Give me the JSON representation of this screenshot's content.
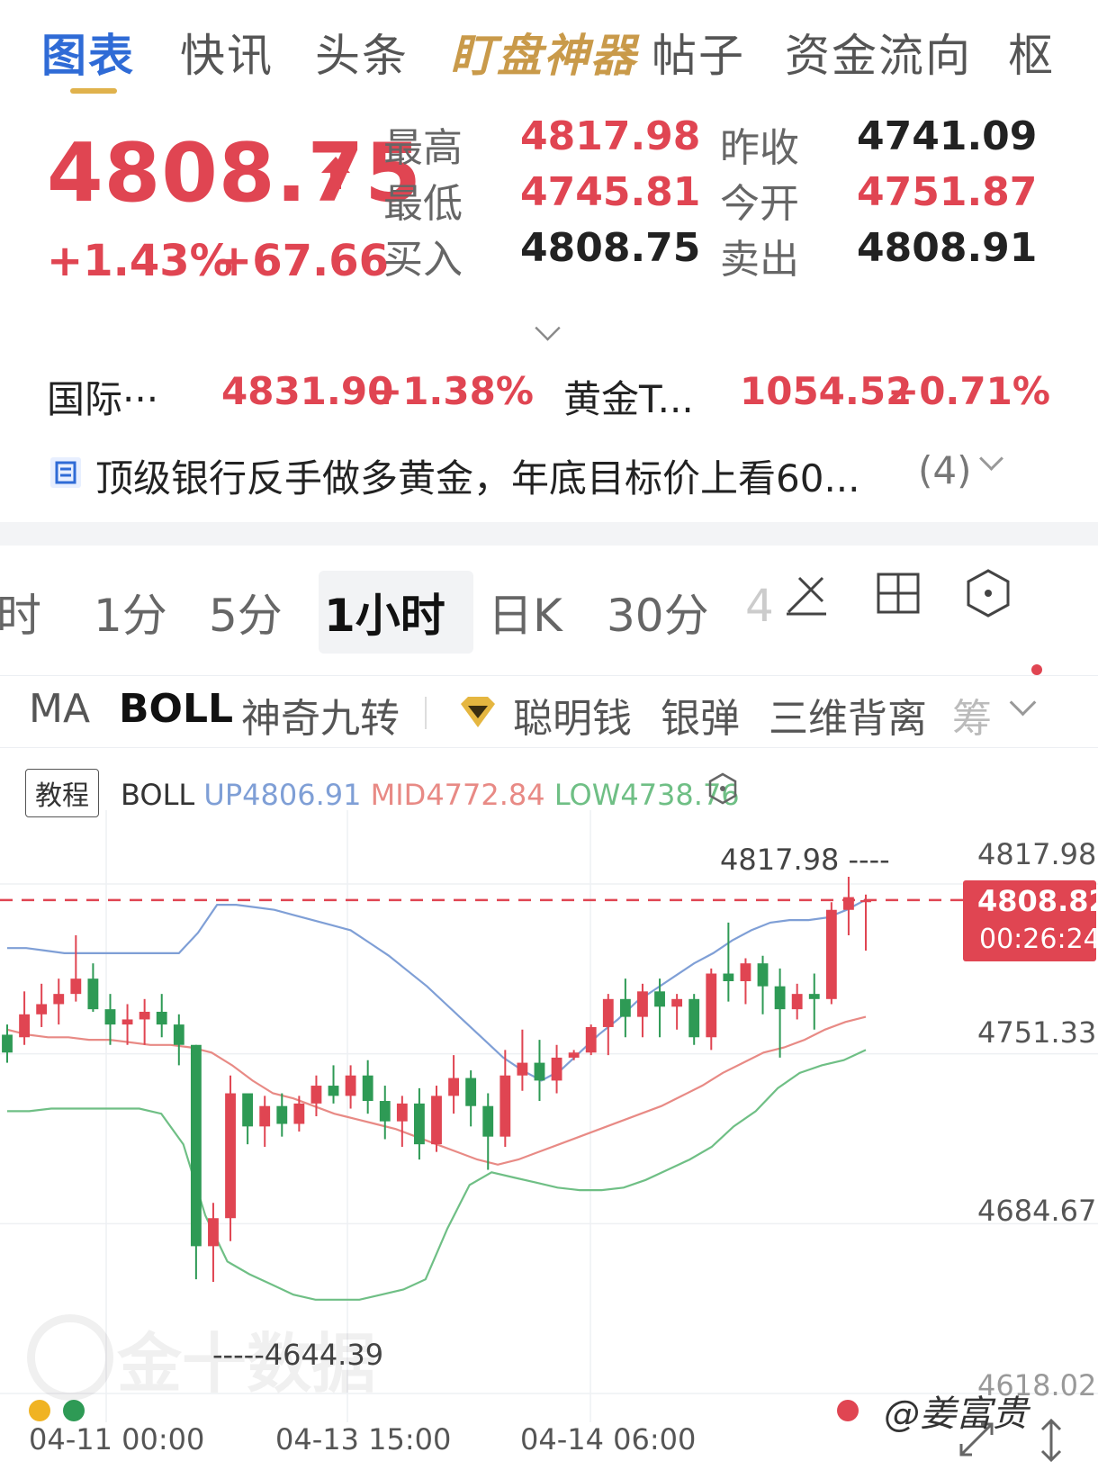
{
  "tabs": [
    "图表",
    "快讯",
    "头条",
    "盯盘神器",
    "帖子",
    "资金流向",
    "枢"
  ],
  "quote": {
    "price": "4808.75",
    "change_pct": "+1.43%",
    "change_abs": "+67.66",
    "high_label": "最高",
    "high": "4817.98",
    "low_label": "最低",
    "low": "4745.81",
    "bid_label": "买入",
    "bid": "4808.75",
    "prev_close_label": "昨收",
    "prev_close": "4741.09",
    "open_label": "今开",
    "open": "4751.87",
    "ask_label": "卖出",
    "ask": "4808.91"
  },
  "related": [
    {
      "name": "国际···",
      "price": "4831.90",
      "change": "+1.38%"
    },
    {
      "name": "黄金T...",
      "price": "1054.52",
      "change": "+0.71%"
    }
  ],
  "news": {
    "text": "顶级银行反手做多黄金，年底目标价上看60...",
    "count": "(4)"
  },
  "periods": [
    "时",
    "1分",
    "5分",
    "1小时",
    "日K",
    "30分",
    "4"
  ],
  "indicators": [
    "MA",
    "BOLL",
    "神奇九转",
    "聪明钱",
    "银弹",
    "三维背离",
    "筹"
  ],
  "chart_header": {
    "tutorial": "教程",
    "name": "BOLL",
    "up": "UP4806.91",
    "mid": "MID4772.84",
    "low": "LOW4738.76"
  },
  "chart_labels": {
    "high_marker": "4817.98 ----",
    "low_marker": "-----4644.39",
    "watermark": "金十数据",
    "credit": "@姜富贵"
  },
  "colors": {
    "up": "#e04552",
    "down": "#2e9a55",
    "up_band": "#7f9fd6",
    "mid_band": "#e88a85",
    "low_band": "#6fbf85",
    "accent": "#2f6bd6"
  },
  "chart_data": {
    "type": "candlestick",
    "indicator": "BOLL",
    "y_ticks": [
      "4817.98",
      "4751.33",
      "4684.67",
      "4618.02"
    ],
    "current_price": "4808.82",
    "countdown": "00:26:24",
    "x_ticks": [
      "04-11 00:00",
      "04-13 15:00",
      "04-14 06:00"
    ],
    "ylim": [
      4618.02,
      4817.98
    ],
    "candles": [
      [
        4756,
        4760,
        4745,
        4749
      ],
      [
        4755,
        4773,
        4752,
        4764
      ],
      [
        4764,
        4776,
        4759,
        4768
      ],
      [
        4768,
        4778,
        4760,
        4772
      ],
      [
        4772,
        4795,
        4769,
        4778
      ],
      [
        4778,
        4784,
        4765,
        4766
      ],
      [
        4766,
        4772,
        4752,
        4760
      ],
      [
        4760,
        4768,
        4752,
        4762
      ],
      [
        4762,
        4770,
        4752,
        4765
      ],
      [
        4765,
        4772,
        4755,
        4760
      ],
      [
        4760,
        4764,
        4744,
        4752
      ],
      [
        4752,
        4752,
        4660,
        4673
      ],
      [
        4673,
        4690,
        4659,
        4684
      ],
      [
        4684,
        4740,
        4675,
        4733
      ],
      [
        4733,
        4728,
        4713,
        4720
      ],
      [
        4720,
        4732,
        4712,
        4728
      ],
      [
        4728,
        4733,
        4716,
        4721
      ],
      [
        4721,
        4732,
        4718,
        4729
      ],
      [
        4729,
        4740,
        4724,
        4736
      ],
      [
        4736,
        4744,
        4729,
        4732
      ],
      [
        4732,
        4744,
        4727,
        4740
      ],
      [
        4740,
        4746,
        4725,
        4730
      ],
      [
        4730,
        4736,
        4715,
        4722
      ],
      [
        4722,
        4732,
        4712,
        4729
      ],
      [
        4729,
        4735,
        4707,
        4713
      ],
      [
        4713,
        4736,
        4710,
        4732
      ],
      [
        4732,
        4748,
        4725,
        4739
      ],
      [
        4739,
        4742,
        4720,
        4728
      ],
      [
        4728,
        4733,
        4703,
        4716
      ],
      [
        4716,
        4750,
        4712,
        4740
      ],
      [
        4740,
        4758,
        4734,
        4745
      ],
      [
        4745,
        4754,
        4730,
        4738
      ],
      [
        4738,
        4752,
        4733,
        4747
      ],
      [
        4747,
        4750,
        4746,
        4749
      ],
      [
        4749,
        4760,
        4748,
        4759
      ],
      [
        4759,
        4772,
        4748,
        4770
      ],
      [
        4770,
        4778,
        4755,
        4763
      ],
      [
        4763,
        4776,
        4755,
        4773
      ],
      [
        4773,
        4778,
        4755,
        4767
      ],
      [
        4767,
        4772,
        4758,
        4770
      ],
      [
        4770,
        4772,
        4752,
        4755
      ],
      [
        4755,
        4782,
        4750,
        4780
      ],
      [
        4780,
        4800,
        4769,
        4777
      ],
      [
        4777,
        4786,
        4768,
        4784
      ],
      [
        4784,
        4787,
        4764,
        4775
      ],
      [
        4775,
        4782,
        4747,
        4766
      ],
      [
        4766,
        4776,
        4762,
        4772
      ],
      [
        4772,
        4780,
        4758,
        4770
      ],
      [
        4770,
        4808,
        4768,
        4805
      ],
      [
        4805,
        4817.98,
        4795,
        4810
      ],
      [
        4808,
        4811,
        4789,
        4808.82
      ]
    ],
    "boll_up": [
      4790,
      4790,
      4789,
      4788,
      4788,
      4788,
      4788,
      4788,
      4788,
      4788,
      4796,
      4807,
      4807,
      4806,
      4805,
      4803,
      4801,
      4799,
      4797,
      4792,
      4787,
      4781,
      4775,
      4768,
      4761,
      4754,
      4747,
      4742,
      4738,
      4742,
      4749,
      4756,
      4762,
      4769,
      4774,
      4779,
      4784,
      4788,
      4793,
      4797,
      4800,
      4801,
      4801,
      4802,
      4805,
      4809
    ],
    "boll_mid": [
      4758,
      4756,
      4755,
      4755,
      4754,
      4754,
      4753,
      4752,
      4752,
      4751,
      4749,
      4744,
      4738,
      4733,
      4731,
      4728,
      4725,
      4723,
      4721,
      4719,
      4716,
      4713,
      4710,
      4707,
      4705,
      4707,
      4710,
      4713,
      4716,
      4719,
      4722,
      4725,
      4728,
      4732,
      4736,
      4741,
      4745,
      4749,
      4751,
      4754,
      4758,
      4761,
      4763
    ],
    "boll_low": [
      4726,
      4726,
      4727,
      4727,
      4727,
      4727,
      4727,
      4725,
      4713,
      4685,
      4667,
      4662,
      4658,
      4654,
      4652,
      4652,
      4652,
      4654,
      4656,
      4660,
      4680,
      4697,
      4702,
      4700,
      4698,
      4696,
      4695,
      4695,
      4696,
      4699,
      4703,
      4707,
      4712,
      4720,
      4726,
      4735,
      4741,
      4744,
      4746,
      4750
    ]
  }
}
